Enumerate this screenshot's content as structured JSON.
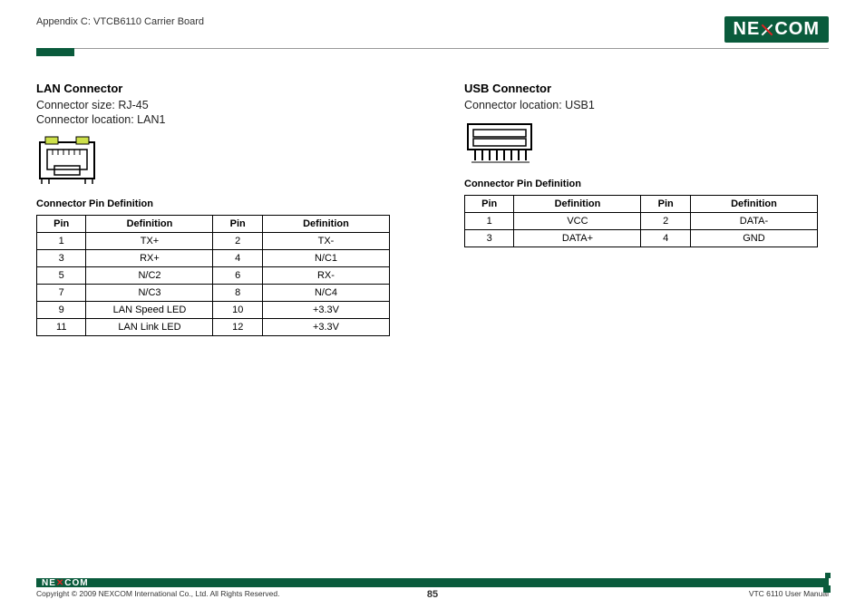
{
  "header": {
    "appendix": "Appendix C: VTCB6110 Carrier Board",
    "logo_left": "NE",
    "logo_right": "COM"
  },
  "lan": {
    "title": "LAN Connector",
    "size": "Connector size: RJ-45",
    "location": "Connector location: LAN1",
    "table_title": "Connector Pin Definition",
    "headers": {
      "pin": "Pin",
      "def": "Definition"
    },
    "rows": [
      {
        "p1": "1",
        "d1": "TX+",
        "p2": "2",
        "d2": "TX-"
      },
      {
        "p1": "3",
        "d1": "RX+",
        "p2": "4",
        "d2": "N/C1"
      },
      {
        "p1": "5",
        "d1": "N/C2",
        "p2": "6",
        "d2": "RX-"
      },
      {
        "p1": "7",
        "d1": "N/C3",
        "p2": "8",
        "d2": "N/C4"
      },
      {
        "p1": "9",
        "d1": "LAN Speed LED",
        "p2": "10",
        "d2": "+3.3V"
      },
      {
        "p1": "11",
        "d1": "LAN Link LED",
        "p2": "12",
        "d2": "+3.3V"
      }
    ]
  },
  "usb": {
    "title": "USB Connector",
    "location": "Connector location: USB1",
    "table_title": "Connector Pin Definition",
    "headers": {
      "pin": "Pin",
      "def": "Definition"
    },
    "rows": [
      {
        "p1": "1",
        "d1": "VCC",
        "p2": "2",
        "d2": "DATA-"
      },
      {
        "p1": "3",
        "d1": "DATA+",
        "p2": "4",
        "d2": "GND"
      }
    ]
  },
  "footer": {
    "logo_left": "NE",
    "logo_right": "COM",
    "copyright": "Copyright © 2009 NEXCOM International Co., Ltd. All Rights Reserved.",
    "page": "85",
    "manual": "VTC 6110 User Manual"
  }
}
